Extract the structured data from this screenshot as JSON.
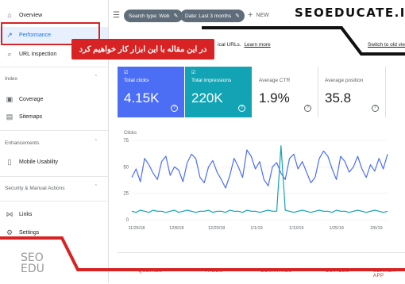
{
  "sidebar": {
    "items": [
      {
        "label": "Overview",
        "icon": "home-icon"
      },
      {
        "label": "Performance",
        "icon": "trend-icon"
      },
      {
        "label": "URL inspection",
        "icon": "search-icon"
      },
      {
        "label": "Coverage",
        "icon": "coverage-icon"
      },
      {
        "label": "Sitemaps",
        "icon": "sitemap-icon"
      },
      {
        "label": "Mobile Usability",
        "icon": "phone-icon"
      },
      {
        "label": "Links",
        "icon": "links-icon"
      },
      {
        "label": "Settings",
        "icon": "gear-icon"
      }
    ],
    "sections": [
      "Index",
      "Enhancements",
      "Security & Manual Actions"
    ]
  },
  "filters": {
    "search_type": "Search type: Web",
    "date": "Date: Last 3 months",
    "new_label": "NEW"
  },
  "brand": "SEOEDUCATE.IR",
  "banner_text": "در این مقاله با این ابزار کار خواهیم کرد",
  "notice": {
    "text": "ical URLs.",
    "link": "Learn more",
    "switch": "Switch to old vie"
  },
  "metrics": [
    {
      "label": "Total clicks",
      "value": "4.15K",
      "bg": "#4c6ef5",
      "fg": "#ffffff"
    },
    {
      "label": "Total impressions",
      "value": "220K",
      "bg": "#12a4b4",
      "fg": "#ffffff"
    },
    {
      "label": "Average CTR",
      "value": "1.9%",
      "bg": "#ffffff",
      "fg": "#202124"
    },
    {
      "label": "Average position",
      "value": "35.8",
      "bg": "#ffffff",
      "fg": "#202124"
    }
  ],
  "logo": {
    "line1": "SEO",
    "line2": "EDU"
  },
  "tabs": [
    "QUERIES",
    "PAGES",
    "COUNTRIES",
    "DEVICES",
    "SEARCH APP"
  ],
  "chart_data": {
    "type": "line",
    "ylabel": "Clicks",
    "ylim": [
      0,
      75
    ],
    "yticks": [
      0,
      25,
      50,
      75
    ],
    "xticks": [
      "11/26/18",
      "12/8/18",
      "12/20/18",
      "1/1/19",
      "1/13/19",
      "1/25/19",
      "2/6/19"
    ],
    "x_index_range": [
      0,
      60
    ],
    "series": [
      {
        "name": "",
        "color": "#4c6ef5",
        "values": [
          40,
          48,
          36,
          58,
          52,
          44,
          38,
          55,
          60,
          42,
          50,
          47,
          36,
          54,
          62,
          58,
          40,
          35,
          50,
          56,
          45,
          38,
          30,
          42,
          58,
          50,
          40,
          66,
          60,
          48,
          55,
          38,
          32,
          50,
          54,
          44,
          38,
          58,
          62,
          48,
          55,
          45,
          35,
          40,
          58,
          65,
          60,
          48,
          38,
          60,
          55,
          45,
          50,
          60,
          48,
          40,
          52,
          46,
          58,
          48,
          62
        ]
      },
      {
        "name": "",
        "color": "#12a4b4",
        "values": [
          8,
          7,
          9,
          8,
          7,
          9,
          8,
          8,
          7,
          8,
          9,
          7,
          8,
          9,
          8,
          7,
          8,
          8,
          9,
          7,
          8,
          8,
          7,
          9,
          8,
          8,
          7,
          9,
          8,
          8,
          7,
          8,
          9,
          8,
          8,
          70,
          9,
          8,
          7,
          8,
          9,
          8,
          7,
          8,
          9,
          8,
          8,
          7,
          9,
          8,
          8,
          7,
          8,
          9,
          8,
          7,
          8,
          9,
          8,
          7,
          8
        ]
      }
    ]
  }
}
